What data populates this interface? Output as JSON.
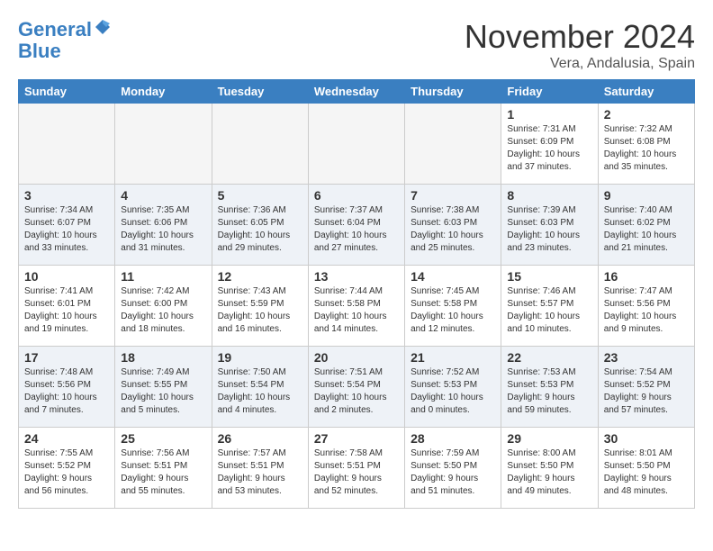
{
  "header": {
    "logo_line1": "General",
    "logo_line2": "Blue",
    "month_title": "November 2024",
    "location": "Vera, Andalusia, Spain"
  },
  "weekdays": [
    "Sunday",
    "Monday",
    "Tuesday",
    "Wednesday",
    "Thursday",
    "Friday",
    "Saturday"
  ],
  "weeks": [
    {
      "days": [
        {
          "num": "",
          "empty": true
        },
        {
          "num": "",
          "empty": true
        },
        {
          "num": "",
          "empty": true
        },
        {
          "num": "",
          "empty": true
        },
        {
          "num": "",
          "empty": true
        },
        {
          "num": "1",
          "sunrise": "Sunrise: 7:31 AM",
          "sunset": "Sunset: 6:09 PM",
          "daylight": "Daylight: 10 hours and 37 minutes."
        },
        {
          "num": "2",
          "sunrise": "Sunrise: 7:32 AM",
          "sunset": "Sunset: 6:08 PM",
          "daylight": "Daylight: 10 hours and 35 minutes."
        }
      ]
    },
    {
      "days": [
        {
          "num": "3",
          "sunrise": "Sunrise: 7:34 AM",
          "sunset": "Sunset: 6:07 PM",
          "daylight": "Daylight: 10 hours and 33 minutes."
        },
        {
          "num": "4",
          "sunrise": "Sunrise: 7:35 AM",
          "sunset": "Sunset: 6:06 PM",
          "daylight": "Daylight: 10 hours and 31 minutes."
        },
        {
          "num": "5",
          "sunrise": "Sunrise: 7:36 AM",
          "sunset": "Sunset: 6:05 PM",
          "daylight": "Daylight: 10 hours and 29 minutes."
        },
        {
          "num": "6",
          "sunrise": "Sunrise: 7:37 AM",
          "sunset": "Sunset: 6:04 PM",
          "daylight": "Daylight: 10 hours and 27 minutes."
        },
        {
          "num": "7",
          "sunrise": "Sunrise: 7:38 AM",
          "sunset": "Sunset: 6:03 PM",
          "daylight": "Daylight: 10 hours and 25 minutes."
        },
        {
          "num": "8",
          "sunrise": "Sunrise: 7:39 AM",
          "sunset": "Sunset: 6:03 PM",
          "daylight": "Daylight: 10 hours and 23 minutes."
        },
        {
          "num": "9",
          "sunrise": "Sunrise: 7:40 AM",
          "sunset": "Sunset: 6:02 PM",
          "daylight": "Daylight: 10 hours and 21 minutes."
        }
      ]
    },
    {
      "days": [
        {
          "num": "10",
          "sunrise": "Sunrise: 7:41 AM",
          "sunset": "Sunset: 6:01 PM",
          "daylight": "Daylight: 10 hours and 19 minutes."
        },
        {
          "num": "11",
          "sunrise": "Sunrise: 7:42 AM",
          "sunset": "Sunset: 6:00 PM",
          "daylight": "Daylight: 10 hours and 18 minutes."
        },
        {
          "num": "12",
          "sunrise": "Sunrise: 7:43 AM",
          "sunset": "Sunset: 5:59 PM",
          "daylight": "Daylight: 10 hours and 16 minutes."
        },
        {
          "num": "13",
          "sunrise": "Sunrise: 7:44 AM",
          "sunset": "Sunset: 5:58 PM",
          "daylight": "Daylight: 10 hours and 14 minutes."
        },
        {
          "num": "14",
          "sunrise": "Sunrise: 7:45 AM",
          "sunset": "Sunset: 5:58 PM",
          "daylight": "Daylight: 10 hours and 12 minutes."
        },
        {
          "num": "15",
          "sunrise": "Sunrise: 7:46 AM",
          "sunset": "Sunset: 5:57 PM",
          "daylight": "Daylight: 10 hours and 10 minutes."
        },
        {
          "num": "16",
          "sunrise": "Sunrise: 7:47 AM",
          "sunset": "Sunset: 5:56 PM",
          "daylight": "Daylight: 10 hours and 9 minutes."
        }
      ]
    },
    {
      "days": [
        {
          "num": "17",
          "sunrise": "Sunrise: 7:48 AM",
          "sunset": "Sunset: 5:56 PM",
          "daylight": "Daylight: 10 hours and 7 minutes."
        },
        {
          "num": "18",
          "sunrise": "Sunrise: 7:49 AM",
          "sunset": "Sunset: 5:55 PM",
          "daylight": "Daylight: 10 hours and 5 minutes."
        },
        {
          "num": "19",
          "sunrise": "Sunrise: 7:50 AM",
          "sunset": "Sunset: 5:54 PM",
          "daylight": "Daylight: 10 hours and 4 minutes."
        },
        {
          "num": "20",
          "sunrise": "Sunrise: 7:51 AM",
          "sunset": "Sunset: 5:54 PM",
          "daylight": "Daylight: 10 hours and 2 minutes."
        },
        {
          "num": "21",
          "sunrise": "Sunrise: 7:52 AM",
          "sunset": "Sunset: 5:53 PM",
          "daylight": "Daylight: 10 hours and 0 minutes."
        },
        {
          "num": "22",
          "sunrise": "Sunrise: 7:53 AM",
          "sunset": "Sunset: 5:53 PM",
          "daylight": "Daylight: 9 hours and 59 minutes."
        },
        {
          "num": "23",
          "sunrise": "Sunrise: 7:54 AM",
          "sunset": "Sunset: 5:52 PM",
          "daylight": "Daylight: 9 hours and 57 minutes."
        }
      ]
    },
    {
      "days": [
        {
          "num": "24",
          "sunrise": "Sunrise: 7:55 AM",
          "sunset": "Sunset: 5:52 PM",
          "daylight": "Daylight: 9 hours and 56 minutes."
        },
        {
          "num": "25",
          "sunrise": "Sunrise: 7:56 AM",
          "sunset": "Sunset: 5:51 PM",
          "daylight": "Daylight: 9 hours and 55 minutes."
        },
        {
          "num": "26",
          "sunrise": "Sunrise: 7:57 AM",
          "sunset": "Sunset: 5:51 PM",
          "daylight": "Daylight: 9 hours and 53 minutes."
        },
        {
          "num": "27",
          "sunrise": "Sunrise: 7:58 AM",
          "sunset": "Sunset: 5:51 PM",
          "daylight": "Daylight: 9 hours and 52 minutes."
        },
        {
          "num": "28",
          "sunrise": "Sunrise: 7:59 AM",
          "sunset": "Sunset: 5:50 PM",
          "daylight": "Daylight: 9 hours and 51 minutes."
        },
        {
          "num": "29",
          "sunrise": "Sunrise: 8:00 AM",
          "sunset": "Sunset: 5:50 PM",
          "daylight": "Daylight: 9 hours and 49 minutes."
        },
        {
          "num": "30",
          "sunrise": "Sunrise: 8:01 AM",
          "sunset": "Sunset: 5:50 PM",
          "daylight": "Daylight: 9 hours and 48 minutes."
        }
      ]
    }
  ]
}
